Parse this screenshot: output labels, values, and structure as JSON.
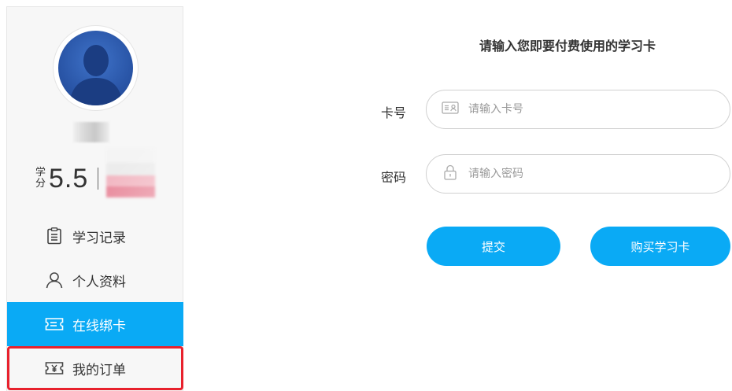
{
  "sidebar": {
    "credits_label_top": "学",
    "credits_label_bottom": "分",
    "credits_value": "5.5",
    "nav": [
      {
        "label": "学习记录",
        "icon": "clipboard-icon",
        "active": false
      },
      {
        "label": "个人资料",
        "icon": "user-icon",
        "active": false
      },
      {
        "label": "在线绑卡",
        "icon": "card-ticket-icon",
        "active": true
      },
      {
        "label": "我的订单",
        "icon": "yen-ticket-icon",
        "active": false,
        "highlighted": true
      }
    ]
  },
  "main": {
    "title": "请输入您即要付费使用的学习卡",
    "card_number": {
      "label": "卡号",
      "placeholder": "请输入卡号",
      "value": ""
    },
    "password": {
      "label": "密码",
      "placeholder": "请输入密码",
      "value": ""
    },
    "submit_label": "提交",
    "buy_label": "购买学习卡"
  },
  "colors": {
    "accent": "#0aaaf5",
    "highlight_border": "#e8212d"
  }
}
